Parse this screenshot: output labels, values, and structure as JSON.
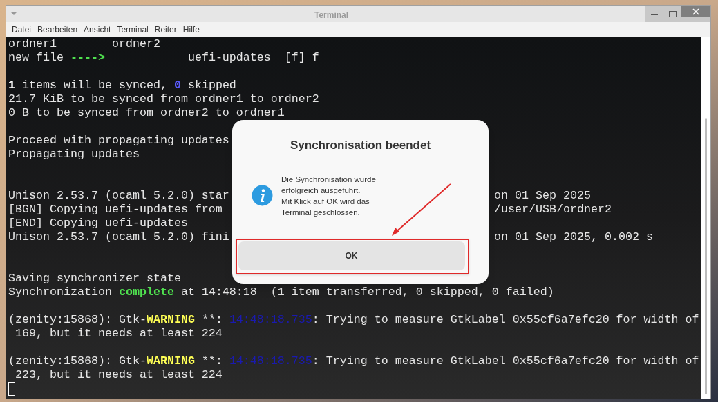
{
  "window": {
    "title": "Terminal"
  },
  "menu": [
    "Datei",
    "Bearbeiten",
    "Ansicht",
    "Terminal",
    "Reiter",
    "Hilfe"
  ],
  "terminal_lines": [
    {
      "kind": "text",
      "segments": [
        {
          "text": "ordner1        ordner2",
          "kind": "plain"
        }
      ]
    },
    {
      "kind": "text",
      "segments": [
        {
          "text": "new file ",
          "kind": "plain"
        },
        {
          "text": "---->",
          "kind": "success"
        },
        {
          "text": "            uefi-updates  [f] f",
          "kind": "plain"
        }
      ]
    },
    {
      "kind": "blank"
    },
    {
      "kind": "text",
      "segments": [
        {
          "text": "1",
          "kind": "bold"
        },
        {
          "text": " items will be synced, ",
          "kind": "plain"
        },
        {
          "text": "0",
          "kind": "count"
        },
        {
          "text": " skipped",
          "kind": "plain"
        }
      ]
    },
    {
      "kind": "text",
      "segments": [
        {
          "text": "21.7 KiB to be synced from ordner1 to ordner2",
          "kind": "plain"
        }
      ]
    },
    {
      "kind": "text",
      "segments": [
        {
          "text": "0 B to be synced from ordner2 to ordner1",
          "kind": "plain"
        }
      ]
    },
    {
      "kind": "blank"
    },
    {
      "kind": "text",
      "segments": [
        {
          "text": "Proceed with propagating updates",
          "kind": "plain"
        }
      ]
    },
    {
      "kind": "text",
      "segments": [
        {
          "text": "Propagating updates",
          "kind": "plain"
        }
      ]
    },
    {
      "kind": "blank"
    },
    {
      "kind": "blank"
    },
    {
      "kind": "text",
      "segments": [
        {
          "text": "Unison 2.53.7 (ocaml 5.2.0) star",
          "kind": "plain"
        }
      ],
      "right": "on 01 Sep 2025"
    },
    {
      "kind": "text",
      "segments": [
        {
          "text": "[BGN] Copying uefi-updates from",
          "kind": "plain"
        }
      ],
      "right": "/user/USB/ordner2"
    },
    {
      "kind": "text",
      "segments": [
        {
          "text": "[END] Copying uefi-updates",
          "kind": "plain"
        }
      ]
    },
    {
      "kind": "text",
      "segments": [
        {
          "text": "Unison 2.53.7 (ocaml 5.2.0) fini",
          "kind": "plain"
        }
      ],
      "right": "on 01 Sep 2025, 0.002 s"
    },
    {
      "kind": "blank"
    },
    {
      "kind": "blank"
    },
    {
      "kind": "text",
      "segments": [
        {
          "text": "Saving synchronizer state",
          "kind": "plain"
        }
      ]
    },
    {
      "kind": "text",
      "segments": [
        {
          "text": "Synchronization ",
          "kind": "plain"
        },
        {
          "text": "complete",
          "kind": "success"
        },
        {
          "text": " at 14:48:18  (1 item transferred, 0 skipped, 0 failed)",
          "kind": "plain"
        }
      ]
    },
    {
      "kind": "blank"
    },
    {
      "kind": "text",
      "segments": [
        {
          "text": "(zenity:15868): Gtk-",
          "kind": "plain"
        },
        {
          "text": "WARNING",
          "kind": "warning"
        },
        {
          "text": " **: ",
          "kind": "plain"
        },
        {
          "text": "14:48:18.735",
          "kind": "timestamp"
        },
        {
          "text": ": Trying to measure GtkLabel 0x55cf6a7efc20 for width of",
          "kind": "plain"
        }
      ]
    },
    {
      "kind": "text",
      "segments": [
        {
          "text": " 169, but it needs at least 224",
          "kind": "plain"
        }
      ]
    },
    {
      "kind": "blank"
    },
    {
      "kind": "text",
      "segments": [
        {
          "text": "(zenity:15868): Gtk-",
          "kind": "plain"
        },
        {
          "text": "WARNING",
          "kind": "warning"
        },
        {
          "text": " **: ",
          "kind": "plain"
        },
        {
          "text": "14:48:18.735",
          "kind": "timestamp"
        },
        {
          "text": ": Trying to measure GtkLabel 0x55cf6a7efc20 for width of",
          "kind": "plain"
        }
      ]
    },
    {
      "kind": "text",
      "segments": [
        {
          "text": " 223, but it needs at least 224",
          "kind": "plain"
        }
      ]
    }
  ],
  "dialog": {
    "title": "Synchronisation beendet",
    "message": "Die Synchronisation wurde\nerfolgreich ausgeführt.\nMit Klick auf OK wird das\nTerminal geschlossen.",
    "button": "OK"
  }
}
